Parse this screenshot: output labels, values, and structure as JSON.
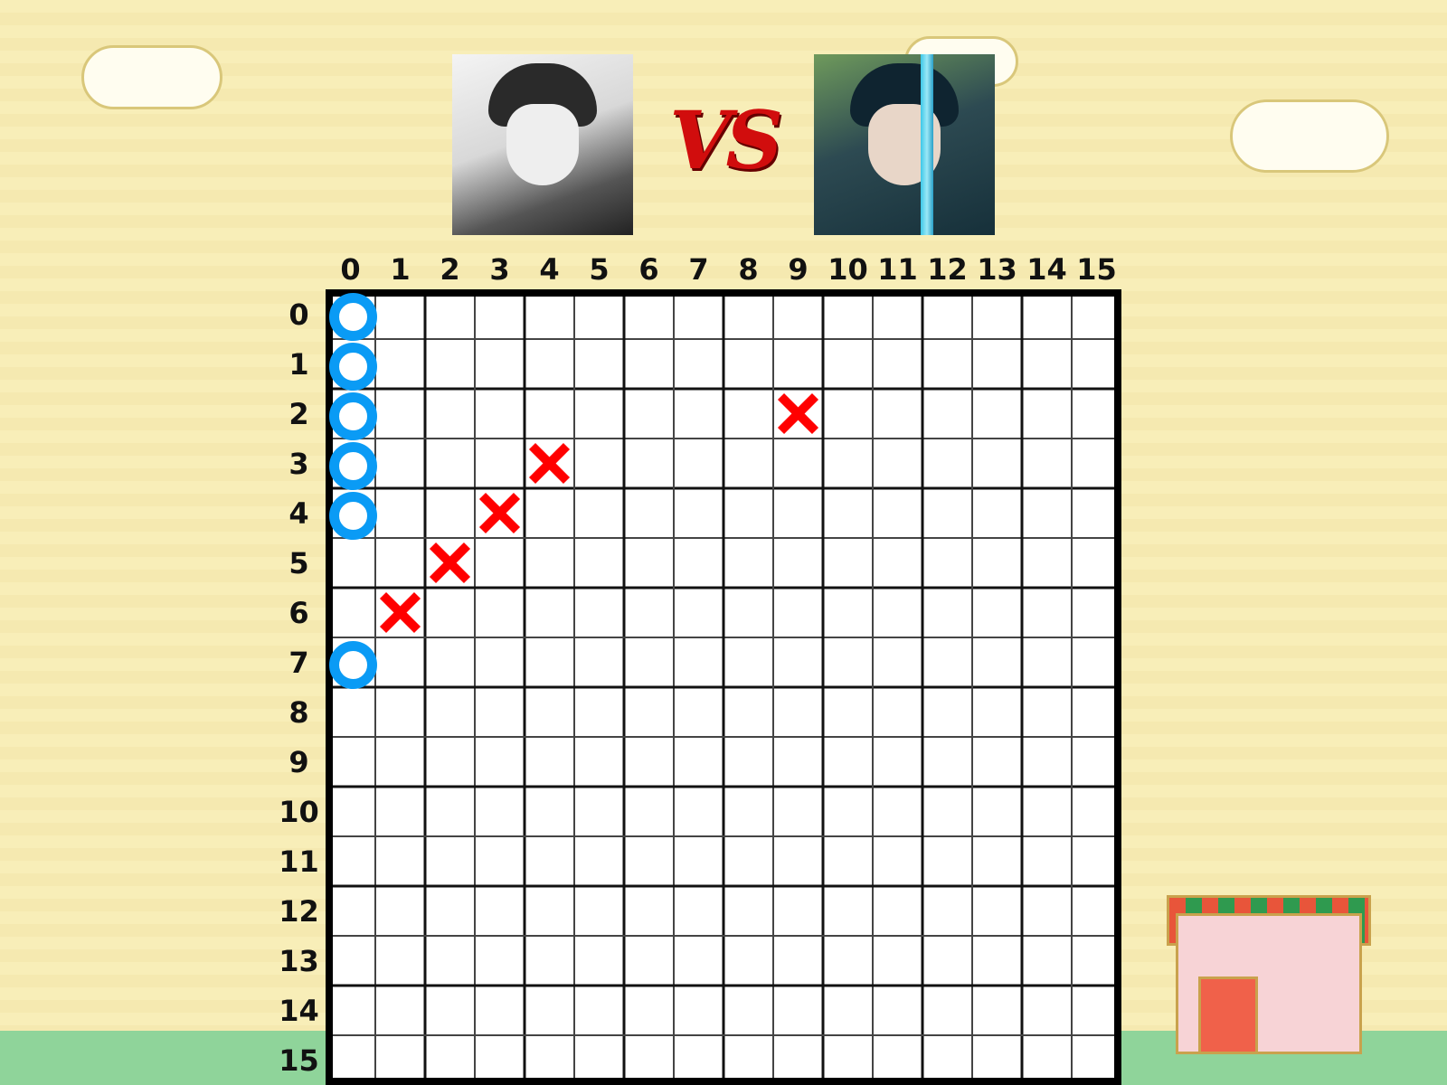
{
  "players": {
    "left": {
      "portrait": "grayscale anime boy in school uniform"
    },
    "right": {
      "portrait": "anime swordsman with blue blade"
    },
    "vs_label": "VS"
  },
  "board": {
    "size": 16,
    "column_labels": [
      "0",
      "1",
      "2",
      "3",
      "4",
      "5",
      "6",
      "7",
      "8",
      "9",
      "10",
      "11",
      "12",
      "13",
      "14",
      "15"
    ],
    "row_labels": [
      "0",
      "1",
      "2",
      "3",
      "4",
      "5",
      "6",
      "7",
      "8",
      "9",
      "10",
      "11",
      "12",
      "13",
      "14",
      "15"
    ],
    "o_color": "#0a9bf5",
    "x_color": "#ff0000",
    "o_marks": [
      [
        0,
        0
      ],
      [
        1,
        0
      ],
      [
        2,
        0
      ],
      [
        3,
        0
      ],
      [
        4,
        0
      ],
      [
        7,
        0
      ]
    ],
    "x_marks": [
      [
        2,
        9
      ],
      [
        3,
        4
      ],
      [
        4,
        3
      ],
      [
        5,
        2
      ],
      [
        6,
        1
      ]
    ]
  }
}
